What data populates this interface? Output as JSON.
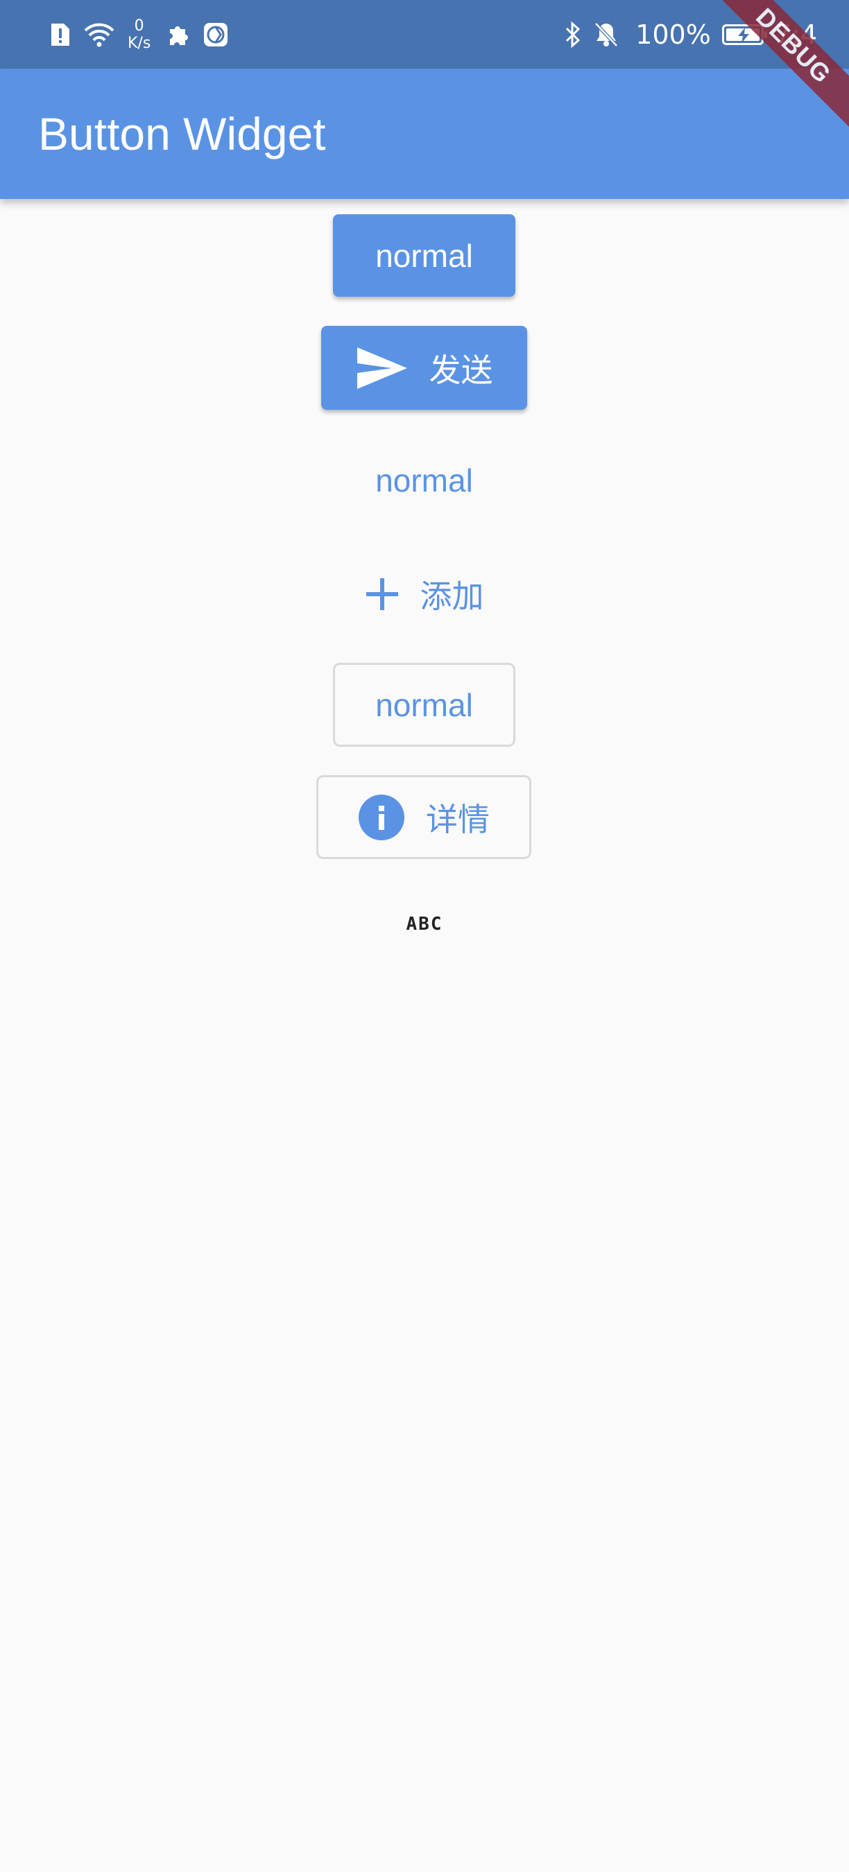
{
  "status_bar": {
    "net_speed_value": "0",
    "net_speed_unit": "K/s",
    "battery_percent": "100%",
    "time": "7:4",
    "icons": [
      "alert-icon",
      "wifi-icon",
      "puzzle-icon",
      "vpn-icon",
      "bluetooth-icon",
      "mute-bell-icon",
      "battery-charging-icon"
    ]
  },
  "debug_banner": "DEBUG",
  "app_bar": {
    "title": "Button Widget"
  },
  "buttons": {
    "elevated": {
      "label": "normal"
    },
    "elevated_icon": {
      "label": "发送",
      "icon": "send-icon"
    },
    "text": {
      "label": "normal"
    },
    "text_icon": {
      "label": "添加",
      "icon": "add-icon"
    },
    "outlined": {
      "label": "normal"
    },
    "outlined_icon": {
      "label": "详情",
      "icon": "info-icon"
    }
  },
  "footer_text": "ABC",
  "colors": {
    "primary": "#5b93e4",
    "status_bar": "#4773b0",
    "background": "#fafafa",
    "outline": "#d9d9d9"
  }
}
